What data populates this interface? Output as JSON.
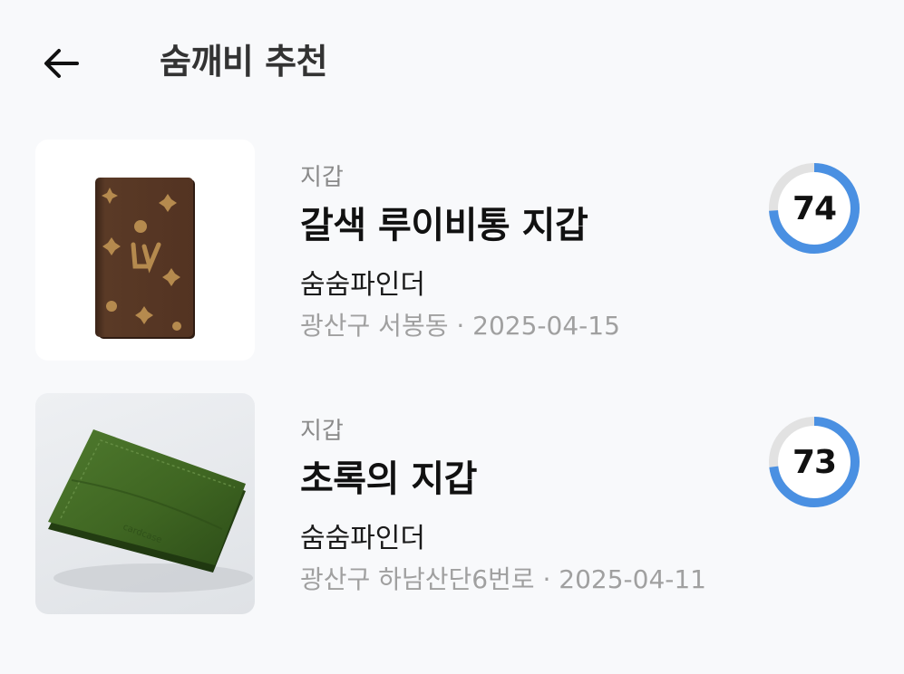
{
  "header": {
    "title": "숨깨비 추천",
    "back_icon": "arrow-left-icon"
  },
  "colors": {
    "background": "#f8f9fb",
    "score_ring": "#4a90e2",
    "score_track": "#e2e2e2",
    "meta_text": "#a0a0a0"
  },
  "items": [
    {
      "category": "지갑",
      "title": "갈색 루이비통 지갑",
      "seller": "숨숨파인더",
      "location": "광산구 서봉동",
      "separator": " · ",
      "date": "2025-04-15",
      "score": 74,
      "image": "brown-monogram-wallet"
    },
    {
      "category": "지갑",
      "title": "초록의 지갑",
      "seller": "숨숨파인더",
      "location": "광산구 하남산단6번로",
      "separator": " · ",
      "date": "2025-04-11",
      "score": 73,
      "image": "green-leather-wallet"
    }
  ]
}
